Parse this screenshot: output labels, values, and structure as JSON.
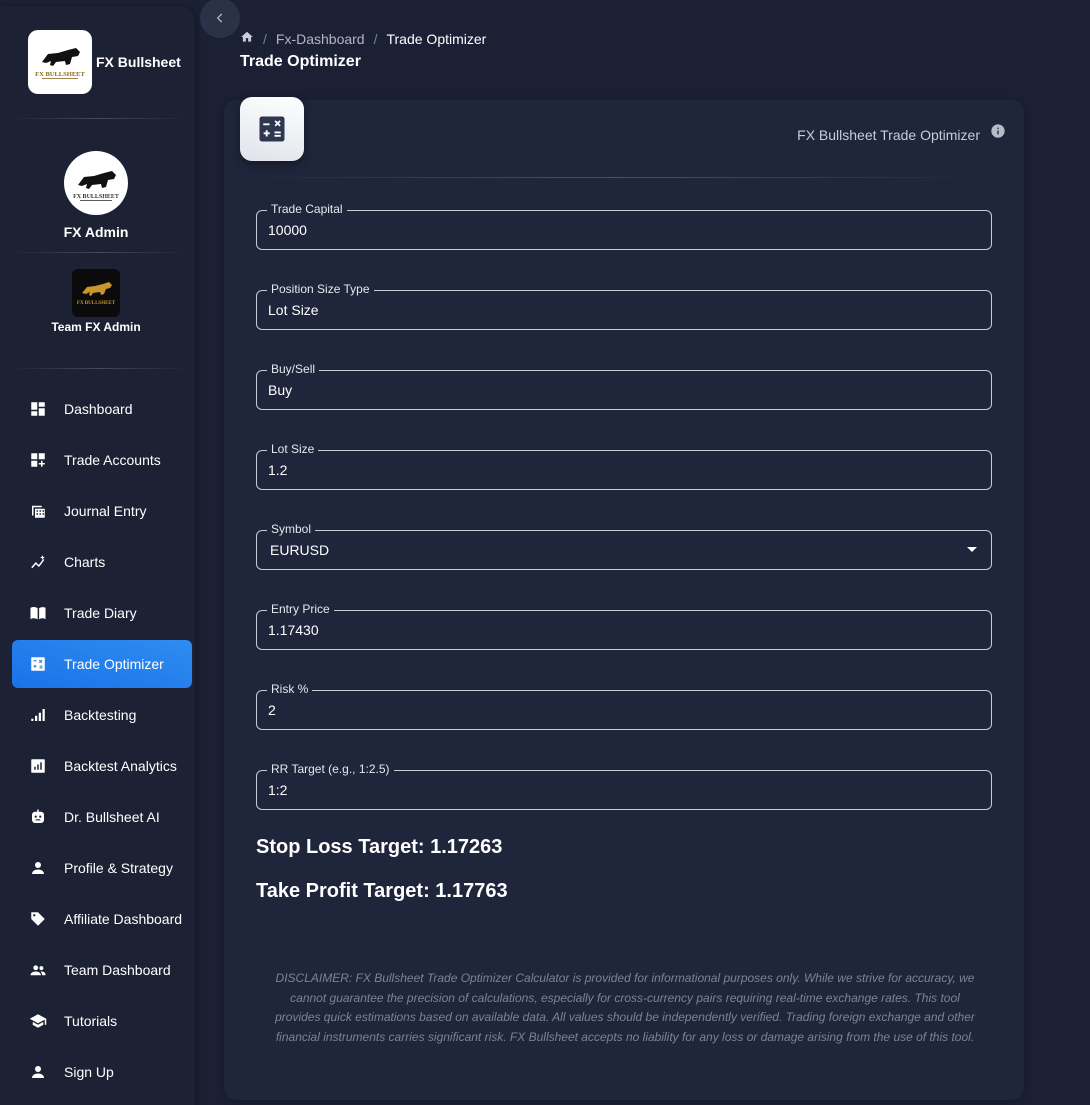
{
  "sidebar": {
    "brand": {
      "name": "FX Bullsheet",
      "logo_text": "FX BULLSHEET"
    },
    "user": {
      "name": "FX Admin",
      "avatar_text": "FX BULLSHEET"
    },
    "team": {
      "name": "Team FX Admin",
      "avatar_text": "FX BULLSHEET"
    },
    "items": [
      {
        "label": "Dashboard",
        "icon": "dashboard-icon"
      },
      {
        "label": "Trade Accounts",
        "icon": "add-widget-icon"
      },
      {
        "label": "Journal Entry",
        "icon": "journal-calendar-icon"
      },
      {
        "label": "Charts",
        "icon": "chart-sparkle-icon"
      },
      {
        "label": "Trade Diary",
        "icon": "book-icon"
      },
      {
        "label": "Trade Optimizer",
        "icon": "calculator-icon",
        "active": true
      },
      {
        "label": "Backtesting",
        "icon": "stairs-icon"
      },
      {
        "label": "Backtest Analytics",
        "icon": "analytics-icon"
      },
      {
        "label": "Dr. Bullsheet AI",
        "icon": "robot-icon"
      },
      {
        "label": "Profile & Strategy",
        "icon": "person-icon"
      },
      {
        "label": "Affiliate Dashboard",
        "icon": "tag-icon"
      },
      {
        "label": "Team Dashboard",
        "icon": "group-icon"
      },
      {
        "label": "Tutorials",
        "icon": "school-icon"
      },
      {
        "label": "Sign Up",
        "icon": "person-icon"
      }
    ]
  },
  "breadcrumb": {
    "items": [
      "Fx-Dashboard",
      "Trade Optimizer"
    ]
  },
  "page": {
    "title": "Trade Optimizer"
  },
  "card": {
    "title": "FX Bullsheet Trade Optimizer",
    "fields": [
      {
        "label": "Trade Capital",
        "value": "10000"
      },
      {
        "label": "Position Size Type",
        "value": "Lot Size"
      },
      {
        "label": "Buy/Sell",
        "value": "Buy"
      },
      {
        "label": "Lot Size",
        "value": "1.2"
      },
      {
        "label": "Symbol",
        "value": "EURUSD",
        "type": "select"
      },
      {
        "label": "Entry Price",
        "value": "1.17430"
      },
      {
        "label": "Risk %",
        "value": "2"
      },
      {
        "label": "RR Target (e.g., 1:2.5)",
        "value": "1:2"
      }
    ],
    "stop_loss": "Stop Loss Target: 1.17263",
    "take_profit": "Take Profit Target: 1.17763",
    "disclaimer": "DISCLAIMER: FX Bullsheet Trade Optimizer Calculator is provided for informational purposes only. While we strive for accuracy, we cannot guarantee the precision of calculations, especially for cross-currency pairs requiring real-time exchange rates. This tool provides quick estimations based on available data. All values should be independently verified. Trading foreign exchange and other financial instruments carries significant risk. FX Bullsheet accepts no liability for any loss or damage arising from the use of this tool."
  },
  "colors": {
    "accent": "#1a73e8",
    "background": "#1b2035",
    "card": "#1f253a"
  }
}
